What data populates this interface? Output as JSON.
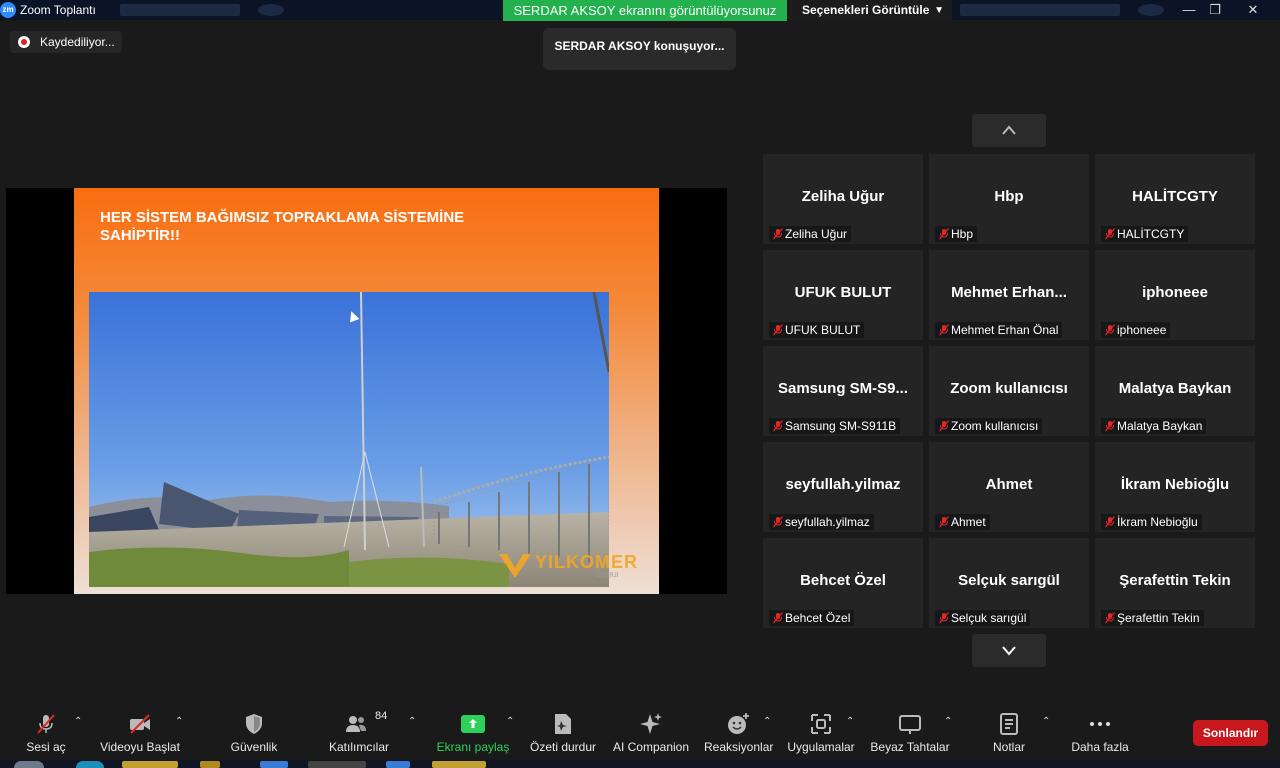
{
  "window": {
    "title": "Zoom Toplantı",
    "app_icon": "zm"
  },
  "banner": {
    "sharing": "SERDAR AKSOY ekranını görüntülüyorsunuz",
    "view_options": "Seçenekleri Görüntüle"
  },
  "recording": {
    "label": "Kaydediliyor..."
  },
  "speaking": {
    "label": "SERDAR AKSOY konuşuyor..."
  },
  "slide": {
    "title": "HER SİSTEM BAĞIMSIZ TOPRAKLAMA SİSTEMİNE SAHİPTİR!!",
    "watermark": "YILKOMER",
    "watermark_sub": "ENERJİ"
  },
  "participants": [
    {
      "display": "Zeliha Uğur",
      "name": "Zeliha Uğur"
    },
    {
      "display": "Hbp",
      "name": "Hbp"
    },
    {
      "display": "HALİTCGTY",
      "name": "HALİTCGTY"
    },
    {
      "display": "UFUK BULUT",
      "name": "UFUK BULUT"
    },
    {
      "display": "Mehmet  Erhan...",
      "name": "Mehmet Erhan Önal"
    },
    {
      "display": "iphoneee",
      "name": "iphoneee"
    },
    {
      "display": "Samsung  SM-S9...",
      "name": "Samsung SM-S911B"
    },
    {
      "display": "Zoom kullanıcısı",
      "name": "Zoom kullanıcısı"
    },
    {
      "display": "Malatya Baykan",
      "name": "Malatya Baykan"
    },
    {
      "display": "seyfullah.yilmaz",
      "name": "seyfullah.yilmaz"
    },
    {
      "display": "Ahmet",
      "name": "Ahmet"
    },
    {
      "display": "İkram Nebioğlu",
      "name": "İkram Nebioğlu"
    },
    {
      "display": "Behcet Özel",
      "name": "Behcet Özel"
    },
    {
      "display": "Selçuk sarıgül",
      "name": "Selçuk sarıgül"
    },
    {
      "display": "Şerafettin Tekin",
      "name": "Şerafettin Tekin"
    }
  ],
  "toolbar": {
    "unmute": "Sesi aç",
    "start_video": "Videoyu Başlat",
    "security": "Güvenlik",
    "participants": "Katılımcılar",
    "participant_count": "84",
    "share_screen": "Ekranı paylaş",
    "stop_summary": "Özeti durdur",
    "ai_companion": "AI Companion",
    "reactions": "Reaksiyonlar",
    "apps": "Uygulamalar",
    "whiteboards": "Beyaz Tahtalar",
    "notes": "Notlar",
    "more": "Daha fazla",
    "end": "Sonlandır"
  },
  "colors": {
    "share_green": "#22b14c",
    "end_red": "#c9171e",
    "slide_orange": "#f96d10",
    "muted_red": "#e02828"
  }
}
